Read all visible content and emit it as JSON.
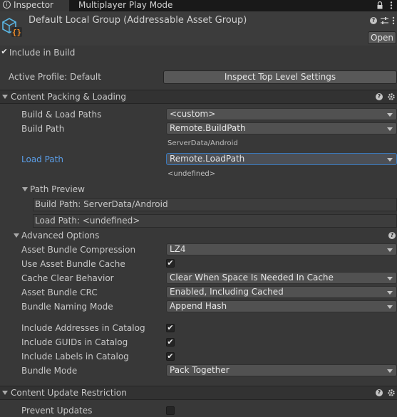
{
  "tabs": [
    {
      "label": "Inspector",
      "active": true
    },
    {
      "label": "Multiplayer Play Mode",
      "active": false
    }
  ],
  "header": {
    "title": "Default Local Group (Addressable Asset Group)",
    "open_label": "Open",
    "include_in_build_label": "Include in Build",
    "include_in_build_checked": true
  },
  "profile": {
    "label": "Active Profile: Default",
    "inspect_button_label": "Inspect Top Level Settings"
  },
  "content_packing": {
    "title": "Content Packing & Loading",
    "build_load_paths": {
      "label": "Build & Load Paths",
      "value": "<custom>"
    },
    "build_path": {
      "label": "Build Path",
      "value": "Remote.BuildPath",
      "resolved": "ServerData/Android"
    },
    "load_path": {
      "label": "Load Path",
      "value": "Remote.LoadPath",
      "resolved": "<undefined>"
    },
    "path_preview": {
      "title": "Path Preview",
      "build_path": "Build Path: ServerData/Android",
      "load_path": "Load Path: <undefined>"
    },
    "advanced": {
      "title": "Advanced Options",
      "compression": {
        "label": "Asset Bundle Compression",
        "value": "LZ4"
      },
      "use_cache": {
        "label": "Use Asset Bundle Cache",
        "checked": true
      },
      "cache_clear": {
        "label": "Cache Clear Behavior",
        "value": "Clear When Space Is Needed In Cache"
      },
      "crc": {
        "label": "Asset Bundle CRC",
        "value": "Enabled, Including Cached"
      },
      "naming": {
        "label": "Bundle Naming Mode",
        "value": "Append Hash"
      },
      "include_addresses": {
        "label": "Include Addresses in Catalog",
        "checked": true
      },
      "include_guids": {
        "label": "Include GUIDs in Catalog",
        "checked": true
      },
      "include_labels": {
        "label": "Include Labels in Catalog",
        "checked": true
      },
      "bundle_mode": {
        "label": "Bundle Mode",
        "value": "Pack Together"
      }
    }
  },
  "content_update": {
    "title": "Content Update Restriction",
    "prevent_updates": {
      "label": "Prevent Updates",
      "checked": false
    }
  },
  "colors": {
    "background": "#383838",
    "tab_bar": "#191919",
    "section_header": "#323232",
    "focus_accent": "#3a79bb",
    "load_path_label": "#5b9ee8"
  },
  "icons": {
    "inspector_tab": "info-icon",
    "asset": "addressable-group-icon",
    "help": "help-icon",
    "presets": "presets-icon",
    "menu": "kebab-menu-icon",
    "settings": "gear-icon",
    "lock": "lock-icon"
  }
}
